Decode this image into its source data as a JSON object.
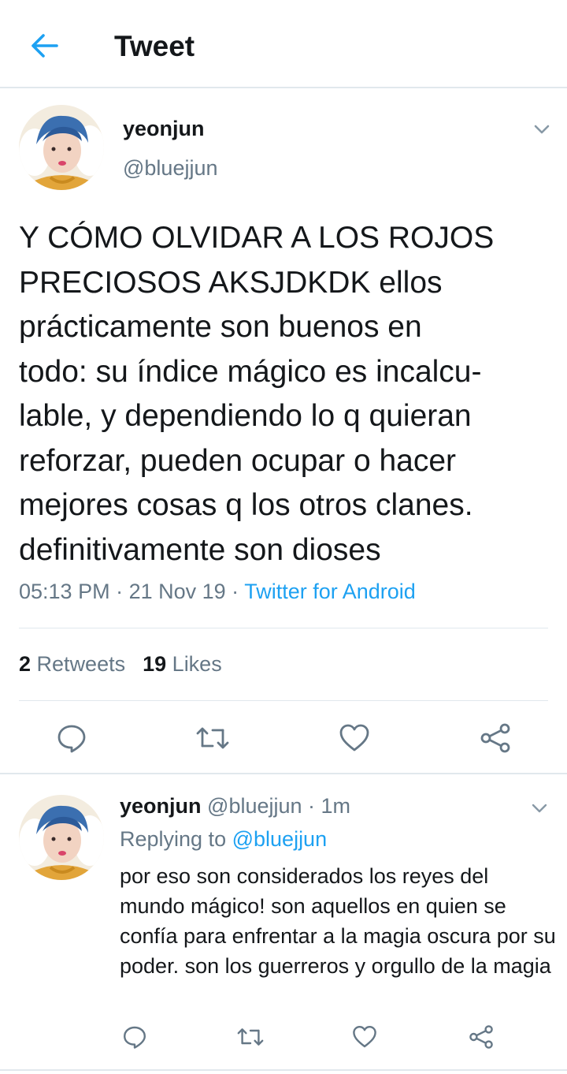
{
  "header": {
    "back_icon": "arrow-left-icon",
    "title": "Tweet",
    "accent_color": "#1da1f2"
  },
  "tweet": {
    "display_name": "yeonjun",
    "handle": "@bluejjun",
    "text": "Y CÓMO OLVIDAR A LOS ROJOS\nPRECIOSOS AKSJDKDK ellos\nprácticamente son buenos en\ntodo: su índice mágico es incalcu-\nlable, y dependiendo lo q quieran\nreforzar, pueden ocupar o hacer\nmejores cosas q los otros clanes.\ndefinitivamente son dioses",
    "time": "05:13 PM",
    "date": "21 Nov 19",
    "source": "Twitter for Android",
    "separator": " · ",
    "retweet_count": "2",
    "retweet_label": "Retweets",
    "like_count": "19",
    "like_label": "Likes",
    "actions": [
      "reply-icon",
      "retweet-icon",
      "like-icon",
      "share-icon"
    ]
  },
  "reply": {
    "display_name": "yeonjun",
    "handle": "@bluejjun",
    "age": "1m",
    "separator": " · ",
    "replying_label": "Replying to",
    "replying_to": "@bluejjun",
    "text": "por eso son considerados los reyes del mundo mágico! son aquellos en quien se confía para enfrentar a la magia oscura por su poder. son los guerreros y orgullo de la magia",
    "actions": [
      "reply-icon",
      "retweet-icon",
      "like-icon",
      "share-icon"
    ]
  },
  "colors": {
    "text": "#14171a",
    "secondary": "#657786",
    "link": "#1da1f2",
    "divider": "#e1e8ed"
  }
}
